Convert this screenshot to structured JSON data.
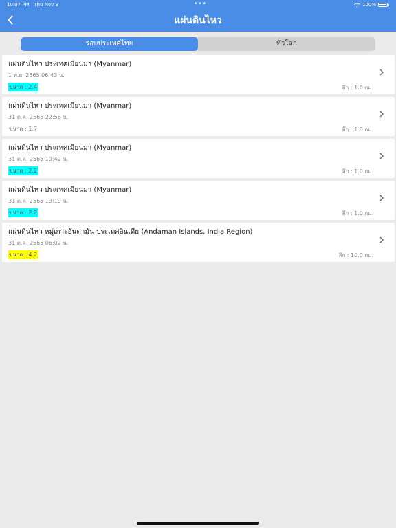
{
  "status_bar": {
    "time": "10:07 PM",
    "date": "Thu Nov 3",
    "battery": "100%"
  },
  "header": {
    "title": "แผ่นดินไหว",
    "back_icon": "chevron-left-icon"
  },
  "tabs": [
    {
      "label": "รอบประเทศไทย",
      "active": true
    },
    {
      "label": "ทั่วโลก",
      "active": false
    }
  ],
  "quakes": [
    {
      "title": "แผ่นดินไหว ประเทศเมียนมา (Myanmar)",
      "datetime": "1 พ.ย. 2565 06:43 น.",
      "magnitude": "ขนาด : 2.4",
      "depth": "ลึก : 1.0 กม.",
      "highlight": "#00ffff"
    },
    {
      "title": "แผ่นดินไหว ประเทศเมียนมา (Myanmar)",
      "datetime": "31 ต.ค. 2565 22:56 น.",
      "magnitude": "ขนาด : 1.7",
      "depth": "ลึก : 1.0 กม.",
      "highlight": ""
    },
    {
      "title": "แผ่นดินไหว ประเทศเมียนมา (Myanmar)",
      "datetime": "31 ต.ค. 2565 19:42 น.",
      "magnitude": "ขนาด : 2.2",
      "depth": "ลึก : 1.0 กม.",
      "highlight": "#00ffff"
    },
    {
      "title": "แผ่นดินไหว ประเทศเมียนมา (Myanmar)",
      "datetime": "31 ต.ค. 2565 13:19 น.",
      "magnitude": "ขนาด : 2.2",
      "depth": "ลึก : 1.0 กม.",
      "highlight": "#00ffff"
    },
    {
      "title": "แผ่นดินไหว หมู่เกาะอันดามัน ประเทศอินเดีย (Andaman Islands, India Region)",
      "datetime": "31 ต.ค. 2565 06:02 น.",
      "magnitude": "ขนาด : 4.2",
      "depth": "ลึก : 10.0 กม.",
      "highlight": "#ffff00"
    }
  ],
  "colors": {
    "header": "#4a8de6",
    "background": "#ebebeb",
    "cyan_highlight": "#00ffff",
    "yellow_highlight": "#ffff00"
  }
}
